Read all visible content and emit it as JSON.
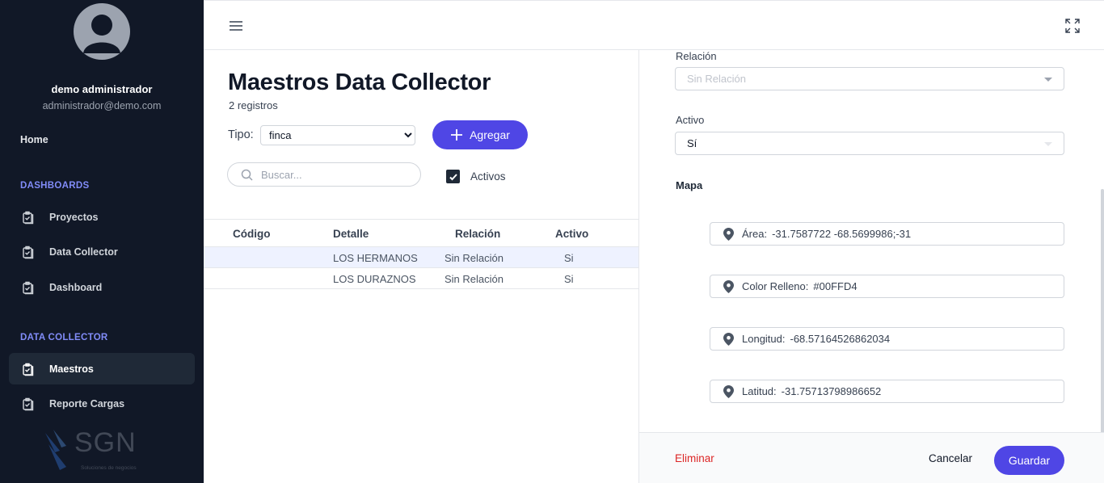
{
  "sidebar": {
    "user": {
      "name": "demo administrador",
      "email": "administrador@demo.com"
    },
    "home_label": "Home",
    "sections": [
      {
        "label": "DASHBOARDS",
        "items": [
          {
            "label": "Proyectos"
          },
          {
            "label": "Data Collector"
          },
          {
            "label": "Dashboard"
          }
        ]
      },
      {
        "label": "DATA COLLECTOR",
        "items": [
          {
            "label": "Maestros",
            "active": true
          },
          {
            "label": "Reporte Cargas"
          }
        ]
      }
    ],
    "logo": {
      "text": "SGN",
      "subtitle": "Soluciones de negocios"
    }
  },
  "header": {
    "menu_icon": "hamburger-icon",
    "fullscreen_icon": "expand-icon"
  },
  "list": {
    "title": "Maestros Data Collector",
    "count": "2 registros",
    "tipo_label": "Tipo:",
    "tipo_value": "finca",
    "add_label": "Agregar",
    "search_placeholder": "Buscar...",
    "activos_label": "Activos",
    "activos_checked": true,
    "columns": {
      "codigo": "Código",
      "detalle": "Detalle",
      "relacion": "Relación",
      "activo": "Activo"
    },
    "rows": [
      {
        "codigo": "",
        "detalle": "LOS HERMANOS",
        "relacion": "Sin Relación",
        "activo": "Si"
      },
      {
        "codigo": "",
        "detalle": "LOS DURAZNOS",
        "relacion": "Sin Relación",
        "activo": "Si"
      }
    ]
  },
  "detail": {
    "relacion_label": "Relación",
    "relacion_value": "Sin Relación",
    "activo_label": "Activo",
    "activo_value": "Sí",
    "mapa_label": "Mapa",
    "map_fields": [
      {
        "label": "Área:",
        "value": "-31.7587722 -68.5699986;-31"
      },
      {
        "label": "Color Relleno:",
        "value": "#00FFD4"
      },
      {
        "label": "Longitud:",
        "value": "-68.57164526862034"
      },
      {
        "label": "Latitud:",
        "value": "-31.75713798986652"
      }
    ],
    "delete_label": "Eliminar",
    "cancel_label": "Cancelar",
    "save_label": "Guardar"
  },
  "colors": {
    "sidebar_bg": "#111827",
    "accent": "#4f46e5",
    "section": "#818cf8",
    "danger": "#dc2626",
    "row_selected": "#eef2ff"
  }
}
